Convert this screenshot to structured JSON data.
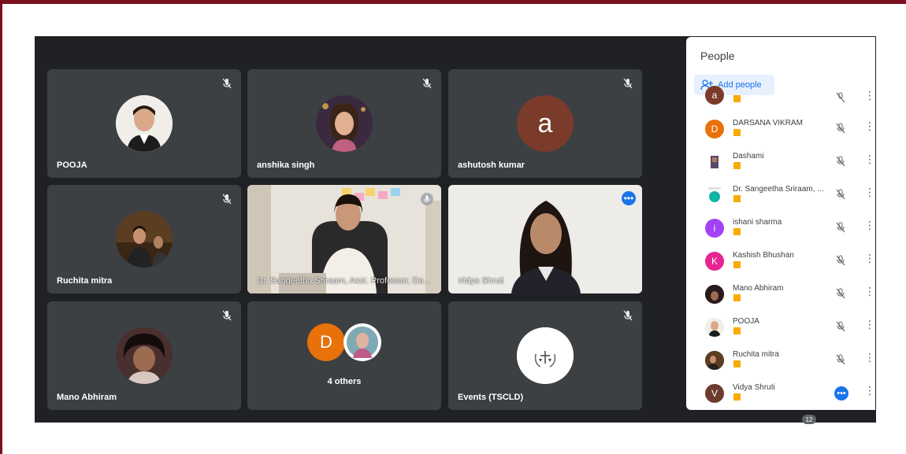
{
  "colors": {
    "frame": "#7a0f1e",
    "meeting_bg": "#202124",
    "tile_bg": "#3c4043",
    "accent_blue": "#1a73e8",
    "badge_yellow": "#f9ab00"
  },
  "tiles": [
    {
      "name": "POOJA",
      "kind": "photo"
    },
    {
      "name": "anshika singh",
      "kind": "photo"
    },
    {
      "name": "ashutosh kumar",
      "kind": "letter",
      "letter": "a",
      "color": "#7b3b2a"
    },
    {
      "name": "Ruchita mitra",
      "kind": "photo"
    },
    {
      "name": "Dr. Sangeetha Sriraam, Asst. Professor, De...",
      "kind": "video"
    },
    {
      "name": "Vidya Shruti",
      "kind": "video"
    },
    {
      "name": "Mano Abhiram",
      "kind": "photo"
    },
    {
      "name": "4 others",
      "kind": "group",
      "letter": "D",
      "color": "#e8710a"
    },
    {
      "name": "Events (TSCLD)",
      "kind": "logo"
    }
  ],
  "panel": {
    "title": "People",
    "add_people_label": "Add people",
    "participants": [
      {
        "name": "",
        "letter": "a",
        "color": "#7b3b2a"
      },
      {
        "name": "DARSANA VIKRAM",
        "letter": "D",
        "color": "#e8710a"
      },
      {
        "name": "Dashami",
        "letter": "",
        "color": "#6b4b3a"
      },
      {
        "name": "Dr. Sangeetha Sriraam, ...",
        "letter": "",
        "color": "#12b5a5"
      },
      {
        "name": "ishani sharma",
        "letter": "i",
        "color": "#a142f4"
      },
      {
        "name": "Kashish Bhushan",
        "letter": "K",
        "color": "#e52592"
      },
      {
        "name": "Mano Abhiram",
        "letter": "",
        "color": "#3a2a2a"
      },
      {
        "name": "POOJA",
        "letter": "",
        "color": "#c9b8a8"
      },
      {
        "name": "Ruchita mitra",
        "letter": "",
        "color": "#5a3a1a"
      },
      {
        "name": "Vidya Shruti",
        "letter": "V",
        "color": "#6d3b2e"
      }
    ]
  },
  "participant_count": "12"
}
